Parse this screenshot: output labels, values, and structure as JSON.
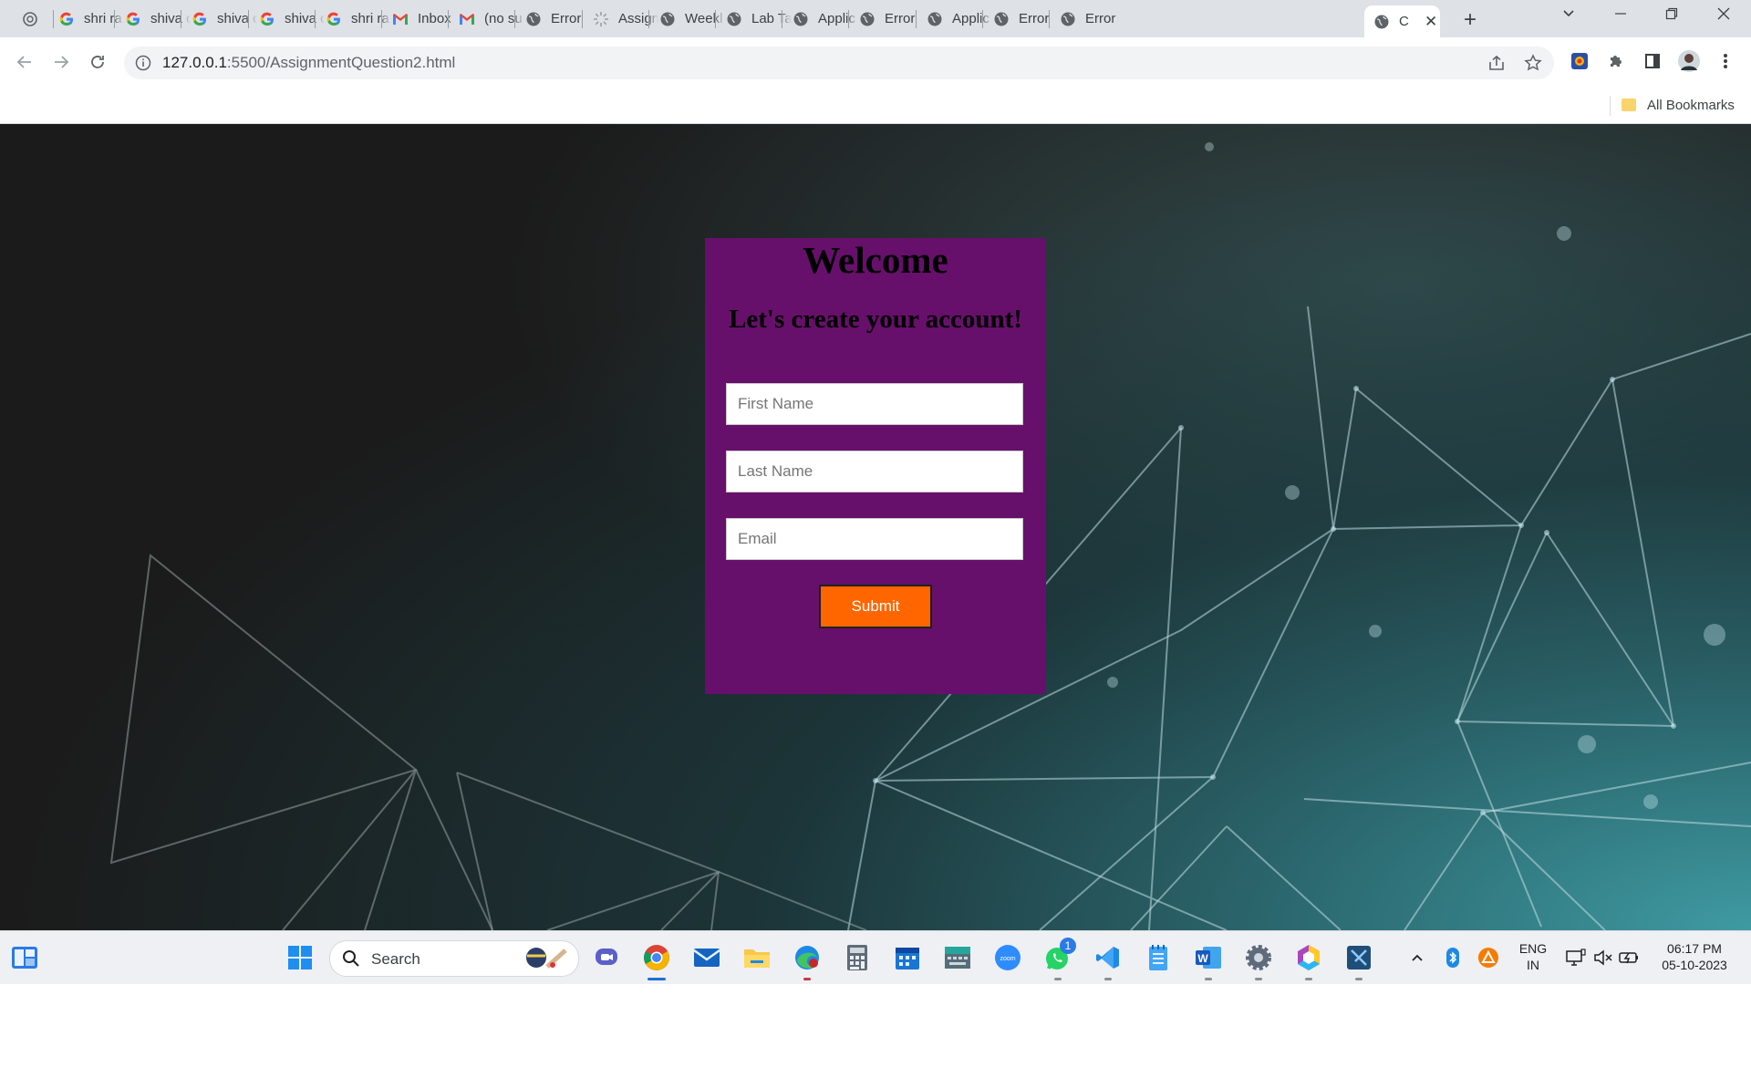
{
  "browser": {
    "tabs": [
      {
        "title": "",
        "icon": "chatgpt-icon"
      },
      {
        "title": "shri ra",
        "icon": "google-icon"
      },
      {
        "title": "shiva c",
        "icon": "google-icon"
      },
      {
        "title": "shiva c",
        "icon": "google-icon"
      },
      {
        "title": "shiva c",
        "icon": "google-icon"
      },
      {
        "title": "shri ra",
        "icon": "google-icon"
      },
      {
        "title": "Inbox",
        "icon": "gmail-icon"
      },
      {
        "title": "(no su",
        "icon": "gmail-icon"
      },
      {
        "title": "Error",
        "icon": "globe-icon"
      },
      {
        "title": "Assign",
        "icon": "loading-icon"
      },
      {
        "title": "Weekl",
        "icon": "globe-icon"
      },
      {
        "title": "Lab Ta",
        "icon": "globe-icon"
      },
      {
        "title": "Applic",
        "icon": "globe-icon"
      },
      {
        "title": "Error",
        "icon": "globe-icon"
      },
      {
        "title": "Applic",
        "icon": "globe-icon"
      },
      {
        "title": "Error",
        "icon": "globe-icon"
      },
      {
        "title": "Error",
        "icon": "globe-icon"
      },
      {
        "title": "C",
        "icon": "globe-icon",
        "active": true
      }
    ],
    "url_host": "127.0.0.1",
    "url_path": ":5500/AssignmentQuestion2.html",
    "bookmarks_label": "All Bookmarks"
  },
  "page": {
    "heading": "Welcome",
    "subheading": "Let's create your account!",
    "first_name_placeholder": "First Name",
    "last_name_placeholder": "Last Name",
    "email_placeholder": "Email",
    "submit_label": "Submit",
    "colors": {
      "card": "#67106b",
      "button": "#ff6600"
    }
  },
  "taskbar": {
    "search_label": "Search",
    "whatsapp_badge": "1",
    "language_top": "ENG",
    "language_bottom": "IN",
    "time": "06:17 PM",
    "date": "05-10-2023"
  }
}
